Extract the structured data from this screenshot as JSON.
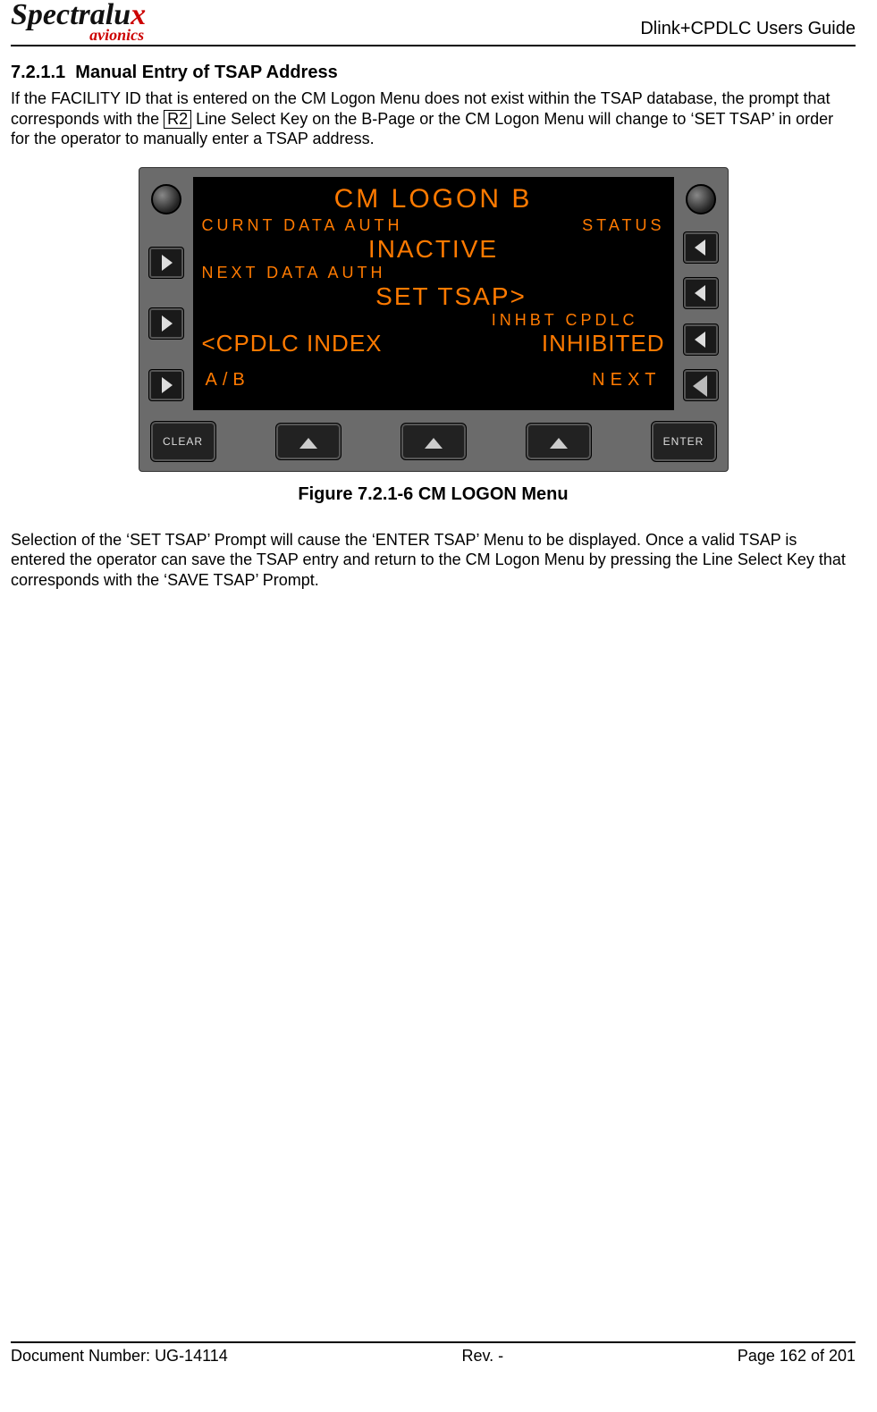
{
  "header": {
    "logo_main_a": "Spectralu",
    "logo_main_x": "x",
    "logo_sub": "avionics",
    "doc_title": "Dlink+CPDLC Users Guide"
  },
  "section": {
    "number": "7.2.1.1",
    "title": "Manual Entry of TSAP Address"
  },
  "para1_a": "If the FACILITY ID that is entered on the CM Logon Menu does not exist within the TSAP database, the prompt that corresponds with the ",
  "para1_box": "R2",
  "para1_b": " Line Select Key on the B-Page or the CM Logon Menu will change to ‘SET TSAP’ in order for the operator to manually enter a TSAP address.",
  "screen": {
    "title": "CM LOGON    B",
    "row1_left": "CURNT DATA AUTH",
    "row1_right": "STATUS",
    "row2_center": "INACTIVE",
    "row3_left": "NEXT DATA AUTH",
    "row4_center": "SET TSAP>",
    "row5_right": "INHBT CPDLC",
    "row6_left": "<CPDLC INDEX",
    "row6_right": "INHIBITED",
    "footer_left": "A/B",
    "footer_right": "NEXT"
  },
  "buttons": {
    "clear": "CLEAR",
    "enter": "ENTER"
  },
  "figure_caption": "Figure 7.2.1-6 CM LOGON Menu",
  "para2": "Selection of the ‘SET TSAP’ Prompt will cause the ‘ENTER TSAP’ Menu to be displayed. Once a valid TSAP is entered the operator can save the TSAP entry and return to the CM Logon Menu by pressing the Line Select Key that corresponds with the ‘SAVE TSAP’ Prompt.",
  "footer": {
    "left_label": "Document Number:  ",
    "left_value": "UG-14114",
    "center_label": "Rev. ",
    "center_value": "-",
    "right_label": "Page ",
    "right_value": "162 of 201"
  }
}
